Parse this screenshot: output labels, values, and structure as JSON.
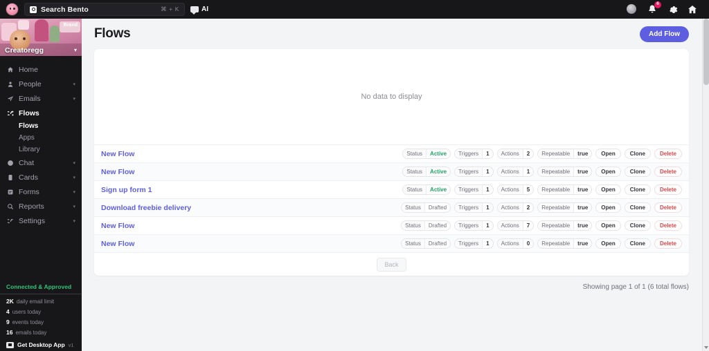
{
  "topbar": {
    "logo_name": "bento-egg-logo",
    "search": {
      "label": "Search Bento",
      "shortcut": "⌘ + K",
      "placeholder": "Search Bento"
    },
    "ai_label": "AI",
    "notification_count": "6"
  },
  "sidebar": {
    "brand": {
      "name": "Creatoregg",
      "banner_tag": "Brand"
    },
    "nav": [
      {
        "label": "Home",
        "icon": "home-icon",
        "chevron": false,
        "active": false
      },
      {
        "label": "People",
        "icon": "person-icon",
        "chevron": true,
        "active": false
      },
      {
        "label": "Emails",
        "icon": "send-icon",
        "chevron": true,
        "active": false
      },
      {
        "label": "Flows",
        "icon": "shuffle-icon",
        "chevron": false,
        "active": true
      },
      {
        "label": "Chat",
        "icon": "chat-icon",
        "chevron": true,
        "active": false
      },
      {
        "label": "Cards",
        "icon": "card-icon",
        "chevron": true,
        "active": false
      },
      {
        "label": "Forms",
        "icon": "form-icon",
        "chevron": true,
        "active": false
      },
      {
        "label": "Reports",
        "icon": "reports-icon",
        "chevron": true,
        "active": false
      },
      {
        "label": "Settings",
        "icon": "settings-icon",
        "chevron": true,
        "active": false
      }
    ],
    "subnav": [
      {
        "label": "Flows",
        "active": true
      },
      {
        "label": "Apps",
        "active": false
      },
      {
        "label": "Library",
        "active": false
      }
    ],
    "status": "Connected & Approved",
    "stats": [
      {
        "num": "2K",
        "text": "daily email limit"
      },
      {
        "num": "4",
        "text": "users today"
      },
      {
        "num": "9",
        "text": "events today"
      },
      {
        "num": "16",
        "text": "emails today"
      }
    ],
    "desktop_app": {
      "label": "Get Desktop App",
      "version": "v1"
    }
  },
  "main": {
    "title": "Flows",
    "add_button": "Add Flow",
    "empty_text": "No data to display",
    "columns": {
      "status": "Status",
      "triggers": "Triggers",
      "actions": "Actions",
      "repeatable": "Repeatable"
    },
    "buttons": {
      "open": "Open",
      "clone": "Clone",
      "delete": "Delete"
    },
    "rows": [
      {
        "name": "New Flow",
        "status": "Active",
        "triggers": "1",
        "actions": "2",
        "repeatable": "true"
      },
      {
        "name": "New Flow",
        "status": "Active",
        "triggers": "1",
        "actions": "1",
        "repeatable": "true"
      },
      {
        "name": "Sign up form 1",
        "status": "Active",
        "triggers": "1",
        "actions": "5",
        "repeatable": "true"
      },
      {
        "name": "Download freebie delivery",
        "status": "Drafted",
        "triggers": "1",
        "actions": "2",
        "repeatable": "true"
      },
      {
        "name": "New Flow",
        "status": "Drafted",
        "triggers": "1",
        "actions": "7",
        "repeatable": "true"
      },
      {
        "name": "New Flow",
        "status": "Drafted",
        "triggers": "1",
        "actions": "0",
        "repeatable": "true"
      }
    ],
    "back_button": "Back",
    "showing": "Showing page 1 of 1 (6 total flows)"
  },
  "colors": {
    "accent": "#5d5fe0",
    "active_green": "#1fa463",
    "danger": "#e0464b",
    "sidebar_bg": "#17171a",
    "badge": "#e8195f"
  }
}
